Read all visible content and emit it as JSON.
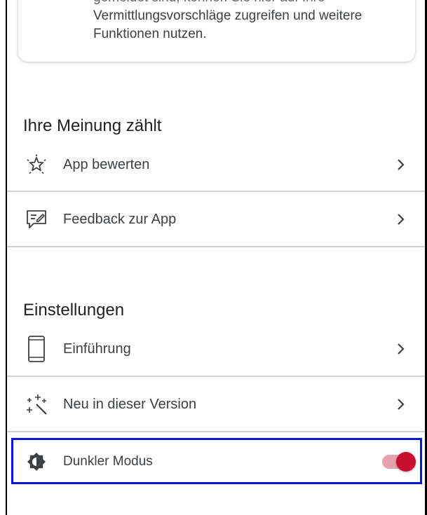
{
  "info_card": {
    "text_line1": "gemeldet sind, können Sie hier auf Ihre",
    "text_line2": "Vermittlungsvorschläge zugreifen und weitere",
    "text_line3": "Funktionen nutzen."
  },
  "feedback_section": {
    "title": "Ihre Meinung zählt",
    "items": [
      {
        "label": "App bewerten",
        "icon": "sparkle-star-icon"
      },
      {
        "label": "Feedback zur App",
        "icon": "feedback-message-icon"
      }
    ]
  },
  "settings_section": {
    "title": "Einstellungen",
    "items": [
      {
        "label": "Einführung",
        "icon": "smartphone-icon"
      },
      {
        "label": "Neu in dieser Version",
        "icon": "magic-wand-icon"
      },
      {
        "label": "Dunkler Modus",
        "icon": "brightness-contrast-icon",
        "toggle_on": true
      }
    ]
  },
  "colors": {
    "accent": "#c8102e",
    "toggle_track": "#e6a3ad",
    "highlight_border": "#0a16d8"
  }
}
